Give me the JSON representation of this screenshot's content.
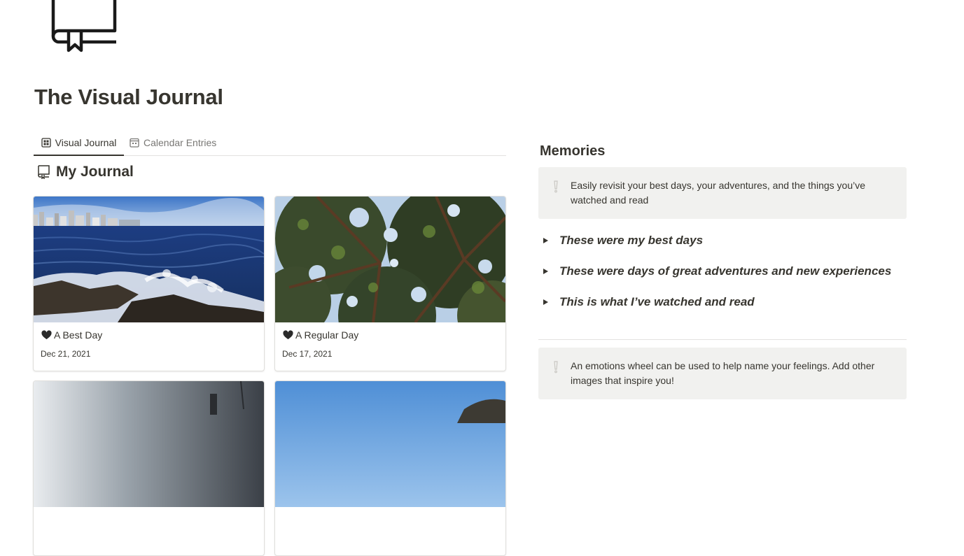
{
  "page": {
    "icon": "book-bookmark-icon",
    "title": "The Visual Journal"
  },
  "tabs": [
    {
      "label": "Visual Journal",
      "icon": "gallery-grid-icon",
      "active": true
    },
    {
      "label": "Calendar Entries",
      "icon": "calendar-icon",
      "active": false
    }
  ],
  "journal": {
    "title": "My Journal",
    "icon": "book-icon",
    "cards": [
      {
        "title": "A Best Day",
        "date": "Dec 21, 2021",
        "emoji": "black-heart-icon"
      },
      {
        "title": "A Regular Day",
        "date": "Dec 17, 2021",
        "emoji": "black-heart-icon"
      }
    ]
  },
  "memories": {
    "title": "Memories",
    "callout_top": "Easily revisit your best days, your adventures, and the things you’ve watched and read",
    "toggles": [
      "These were my best days",
      "These were days of great adventures and new experiences",
      "This is what I’ve watched and read"
    ],
    "callout_bottom": "An emotions wheel can be used to help name your feelings. Add other images that inspire you!"
  },
  "colors": {
    "text": "#37352f",
    "muted": "#787774",
    "callout_bg": "#f1f1ef",
    "divider": "#e3e2e0"
  }
}
